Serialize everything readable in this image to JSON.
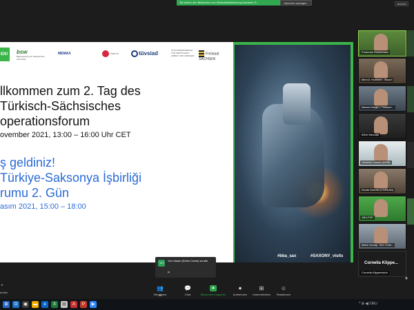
{
  "share_bar": {
    "text": "Sie sehen den Bildschirm von Wirtschaftsförderung Sachsen G...",
    "button": "Optionen anzeigen",
    "view_button": "Ansicht"
  },
  "slide": {
    "logo_green_text": "EN!",
    "logo_bsw": "bsw",
    "logo_bsw_sub": "Bildungswerk der Sächsischen Wirtschaft",
    "logo_mmax": "MEMAX",
    "logo_red": "TÜRKİYE",
    "logo_tw": "tüvsiad",
    "logo_ministry": "STAATSMINISTERIUM FÜR WIRTSCHAFT ARBEIT UND VERKEHR",
    "logo_sachsen": "Freistaat SACHSEN",
    "de_lines": [
      "llkommen zum 2. Tag des",
      "Türkisch-Sächsisches",
      "operationsforum"
    ],
    "de_date": "ovember 2021, 13:00 – 16:00 Uhr CET",
    "tr_lines": [
      "ş geldiniz!",
      "Türkiye-Saksonya İşbirliği",
      "rumu 2. Gün"
    ],
    "tr_date": "asım 2021, 15:00 – 18:00",
    "hashtags": [
      "#bba_sax",
      "#SAXONY_visits"
    ]
  },
  "participants": [
    {
      "name": "Frederick Rosenbaum",
      "active": true
    },
    {
      "name": "Mine A. Huebner - Bosch",
      "active": false
    },
    {
      "name": "Nenzet Sargin | Türkisch...",
      "active": false
    },
    {
      "name": "BSW Wendau",
      "active": false
    },
    {
      "name": "Vanisha Lebnett (WSB)",
      "active": false
    },
    {
      "name": "Sevde Küchen (TÜRKAD)",
      "active": false
    },
    {
      "name": "JMV-FSP",
      "active": false
    },
    {
      "name": "Mahir Günay - B.K CON...",
      "active": false
    }
  ],
  "name_tile": {
    "big_name": "Cornelia Klippe...",
    "name": "Cornelia Klippenstein"
  },
  "chat": {
    "avatar": "VH",
    "from": "Von Hasan (Keles Crane) an alle",
    "message": "ja"
  },
  "toolbar": {
    "left_label": "enden",
    "buttons": [
      {
        "label": "Teilnehmer",
        "icon": "👥",
        "badge": "28"
      },
      {
        "label": "Chat",
        "icon": "💬"
      },
      {
        "label": "Bildschirm freigeben",
        "icon": "▲"
      },
      {
        "label": "Aufnehmen",
        "icon": "⏺"
      },
      {
        "label": "Untereinheiten",
        "icon": "⊞"
      },
      {
        "label": "Reaktionen",
        "icon": "☺"
      }
    ]
  },
  "taskbar": {
    "tray": "^ ⊞ ◀) DEU"
  },
  "colors": {
    "accent_green": "#3bb54a",
    "turkish_blue": "#2b6bd6",
    "share_green": "#2ea44f"
  }
}
